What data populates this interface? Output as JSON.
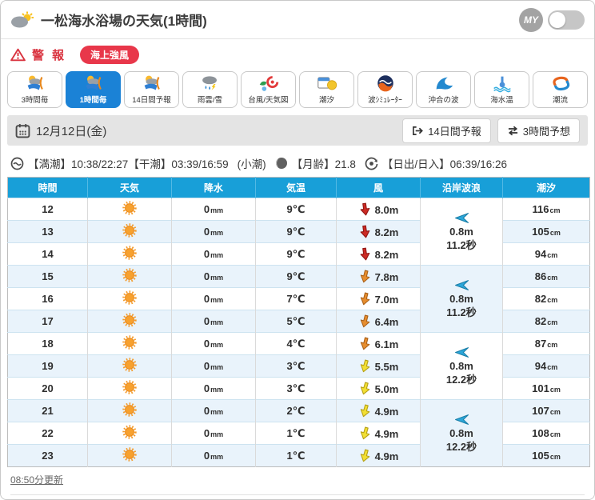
{
  "header": {
    "title": "一松海水浴場の天気(1時間)",
    "my_label": "MY"
  },
  "alert": {
    "label": "警報",
    "badge": "海上強風"
  },
  "tabs": [
    {
      "key": "3h",
      "label": "3時間毎",
      "icon": "suncloud",
      "active": false
    },
    {
      "key": "1h",
      "label": "1時間毎",
      "icon": "suncloud",
      "active": true
    },
    {
      "key": "14d",
      "label": "14日間予報",
      "icon": "suncloud",
      "active": false
    },
    {
      "key": "radar",
      "label": "雨雲/雪",
      "icon": "raincloud",
      "active": false
    },
    {
      "key": "typhoon",
      "label": "台風/天気図",
      "icon": "typhoon",
      "active": false
    },
    {
      "key": "tide",
      "label": "潮汐",
      "icon": "tidecal",
      "active": false
    },
    {
      "key": "wavesim",
      "label": "波ｼﾐｭﾚｰﾀｰ",
      "icon": "wavesim",
      "active": false
    },
    {
      "key": "offshore",
      "label": "沖合の波",
      "icon": "offshore",
      "active": false
    },
    {
      "key": "seatemp",
      "label": "海水温",
      "icon": "seatemp",
      "active": false
    },
    {
      "key": "current",
      "label": "潮流",
      "icon": "current",
      "active": false
    }
  ],
  "datebar": {
    "date": "12月12日(金)",
    "buttons": [
      {
        "key": "forecast14",
        "label": "14日間予報",
        "icon": "external"
      },
      {
        "key": "forecast3h",
        "label": "3時間予想",
        "icon": "swap"
      }
    ]
  },
  "tideinfo": {
    "tide_text": "【満潮】10:38/22:27【干潮】03:39/16:59",
    "phase": "(小潮)",
    "moon_text": "【月齢】21.8",
    "sun_text": "【日出/日入】06:39/16:26"
  },
  "table": {
    "headers": [
      "時間",
      "天気",
      "降水",
      "気温",
      "風",
      "沿岸波浪",
      "潮汐"
    ],
    "rows": [
      {
        "time": "12",
        "weather": "sunny",
        "precip": "0",
        "precip_unit": "mm",
        "temp": "9",
        "temp_unit": "℃",
        "wind": {
          "speed": "8.0m",
          "level": "red",
          "rot": -8
        },
        "tide": "116",
        "tide_unit": "cm"
      },
      {
        "time": "13",
        "weather": "sunny",
        "precip": "0",
        "precip_unit": "mm",
        "temp": "9",
        "temp_unit": "℃",
        "wind": {
          "speed": "8.2m",
          "level": "red",
          "rot": -8
        },
        "tide": "105",
        "tide_unit": "cm"
      },
      {
        "time": "14",
        "weather": "sunny",
        "precip": "0",
        "precip_unit": "mm",
        "temp": "9",
        "temp_unit": "℃",
        "wind": {
          "speed": "8.2m",
          "level": "red",
          "rot": -8
        },
        "tide": "94",
        "tide_unit": "cm"
      },
      {
        "time": "15",
        "weather": "sunny",
        "precip": "0",
        "precip_unit": "mm",
        "temp": "9",
        "temp_unit": "℃",
        "wind": {
          "speed": "7.8m",
          "level": "orange",
          "rot": 14
        },
        "tide": "86",
        "tide_unit": "cm"
      },
      {
        "time": "16",
        "weather": "sunny",
        "precip": "0",
        "precip_unit": "mm",
        "temp": "7",
        "temp_unit": "℃",
        "wind": {
          "speed": "7.0m",
          "level": "orange",
          "rot": 14
        },
        "tide": "82",
        "tide_unit": "cm"
      },
      {
        "time": "17",
        "weather": "sunny",
        "precip": "0",
        "precip_unit": "mm",
        "temp": "5",
        "temp_unit": "℃",
        "wind": {
          "speed": "6.4m",
          "level": "orange",
          "rot": 14
        },
        "tide": "82",
        "tide_unit": "cm"
      },
      {
        "time": "18",
        "weather": "sunny",
        "precip": "0",
        "precip_unit": "mm",
        "temp": "4",
        "temp_unit": "℃",
        "wind": {
          "speed": "6.1m",
          "level": "orange",
          "rot": 14
        },
        "tide": "87",
        "tide_unit": "cm"
      },
      {
        "time": "19",
        "weather": "sunny",
        "precip": "0",
        "precip_unit": "mm",
        "temp": "3",
        "temp_unit": "℃",
        "wind": {
          "speed": "5.5m",
          "level": "yellow",
          "rot": 16
        },
        "tide": "94",
        "tide_unit": "cm"
      },
      {
        "time": "20",
        "weather": "sunny",
        "precip": "0",
        "precip_unit": "mm",
        "temp": "3",
        "temp_unit": "℃",
        "wind": {
          "speed": "5.0m",
          "level": "yellow",
          "rot": 16
        },
        "tide": "101",
        "tide_unit": "cm"
      },
      {
        "time": "21",
        "weather": "sunny",
        "precip": "0",
        "precip_unit": "mm",
        "temp": "2",
        "temp_unit": "℃",
        "wind": {
          "speed": "4.9m",
          "level": "yellow",
          "rot": 16
        },
        "tide": "107",
        "tide_unit": "cm"
      },
      {
        "time": "22",
        "weather": "sunny",
        "precip": "0",
        "precip_unit": "mm",
        "temp": "1",
        "temp_unit": "℃",
        "wind": {
          "speed": "4.9m",
          "level": "yellow",
          "rot": 16
        },
        "tide": "108",
        "tide_unit": "cm"
      },
      {
        "time": "23",
        "weather": "sunny",
        "precip": "0",
        "precip_unit": "mm",
        "temp": "1",
        "temp_unit": "℃",
        "wind": {
          "speed": "4.9m",
          "level": "yellow",
          "rot": 16
        },
        "tide": "105",
        "tide_unit": "cm"
      }
    ],
    "wave_groups": [
      {
        "span": 3,
        "height": "0.8m",
        "period": "11.2秒",
        "direction": "left"
      },
      {
        "span": 3,
        "height": "0.8m",
        "period": "11.2秒",
        "direction": "left"
      },
      {
        "span": 3,
        "height": "0.8m",
        "period": "12.2秒",
        "direction": "left"
      },
      {
        "span": 3,
        "height": "0.8m",
        "period": "12.2秒",
        "direction": "left"
      }
    ]
  },
  "footer": {
    "updated": "08:50分更新"
  },
  "colors": {
    "accent_blue": "#1b82d6",
    "table_header_blue": "#189fd8",
    "alt_row_blue": "#e9f3fb",
    "alert_red": "#e8374a",
    "wind_red": "#cc2a24",
    "wind_orange": "#e68d2e",
    "wind_yellow": "#f2df33",
    "wave_cyan": "#2ba6d9"
  }
}
